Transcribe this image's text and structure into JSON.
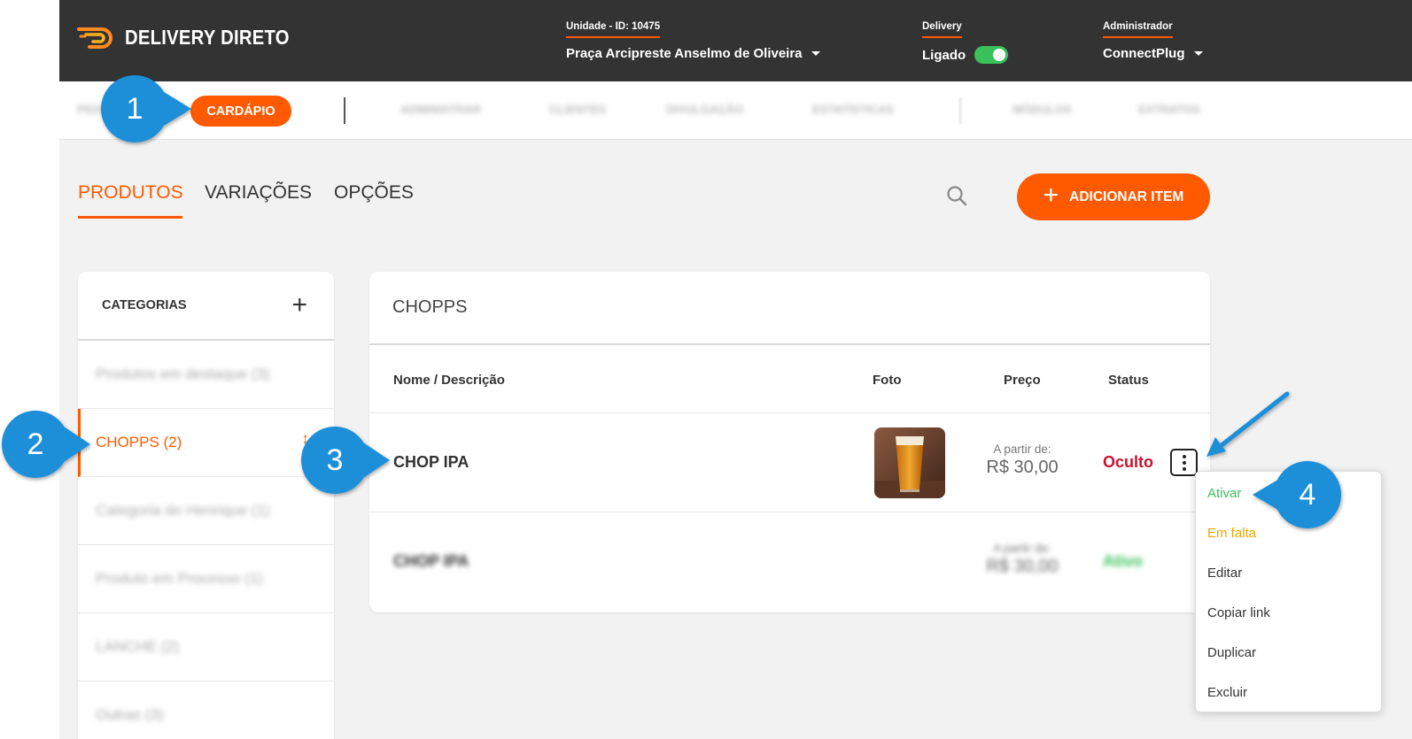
{
  "header": {
    "brand": "DELIVERY DIRETO",
    "unit_label": "Unidade - ID: 10475",
    "unit_value": "Praça Arcipreste Anselmo de Oliveira",
    "delivery_label": "Delivery",
    "delivery_status": "Ligado",
    "delivery_on": true,
    "admin_label": "Administrador",
    "admin_value": "ConnectPlug"
  },
  "nav": {
    "active": "CARDÁPIO",
    "blurred_items": [
      "PEDIDOS",
      "ADMINISTRAR",
      "CLIENTES",
      "DIVULGAÇÃO",
      "ESTATÍSTICAS",
      "MÓDULOS",
      "EXTRATOS"
    ]
  },
  "tabs": [
    "PRODUTOS",
    "VARIAÇÕES",
    "OPÇÕES"
  ],
  "add_button": "ADICIONAR ITEM",
  "categories": {
    "title": "CATEGORIAS",
    "items": [
      {
        "label": "Produtos em destaque (3)",
        "blurred": true
      },
      {
        "label": "CHOPPS (2)",
        "active": true
      },
      {
        "label": "Categoria do Henrique (1)",
        "blurred": true
      },
      {
        "label": "Produto em Processo (1)",
        "blurred": true
      },
      {
        "label": "LANCHE (2)",
        "blurred": true
      },
      {
        "label": "Outras (3)",
        "blurred": true
      }
    ]
  },
  "products": {
    "category_title": "CHOPPS",
    "columns": [
      "Nome / Descrição",
      "Foto",
      "Preço",
      "Status"
    ],
    "rows": [
      {
        "name": "CHOP IPA",
        "price_from": "A partir de:",
        "price": "R$ 30,00",
        "status": "Oculto"
      },
      {
        "name": "CHOP IPA",
        "price_from": "A partir de:",
        "price": "R$ 30,00",
        "status": "Ativo",
        "blurred": true
      }
    ]
  },
  "menu": {
    "items": [
      "Ativar",
      "Em falta",
      "Editar",
      "Copiar link",
      "Duplicar",
      "Excluir"
    ]
  },
  "callouts": [
    "1",
    "2",
    "3",
    "4"
  ],
  "colors": {
    "accent": "#ff5a00",
    "topbar": "#333333",
    "green": "#39c15c",
    "red": "#c8102e",
    "callout": "#1a8fd8"
  }
}
